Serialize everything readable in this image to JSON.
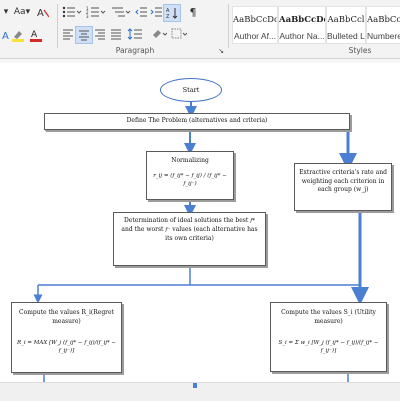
{
  "ribbon": {
    "font_aa": "Aa",
    "paragraph_mark": "¶",
    "styles": [
      {
        "preview": "AaBbCcDc",
        "name": "Author Af..."
      },
      {
        "preview": "AaBbCcDd",
        "name": "Author Na..."
      },
      {
        "preview": "AaBbCcl",
        "name": "Bulleted List"
      },
      {
        "preview": "AaBbCcDd",
        "name": "Numbere..."
      }
    ],
    "paragraph_label": "Paragraph",
    "styles_label": "Styles"
  },
  "flow": {
    "start": "Start",
    "define": "Define The Problem (alternatives and criteria)",
    "normalizing": "Normalizing",
    "normalizing_formula": "r_ij = (f_ij* − f_ij) / (f_ij* − f_ij⁻)",
    "extractive": "Extractive criteria's rate and weighting each criterion in each group (w_j)",
    "ideal_line1": "Determination of ideal solutions the best",
    "ideal_line2": "and the worst",
    "ideal_line3": "values (each alternative has its own criteria)",
    "regret_title": "Compute the values R_i(Regret measure)",
    "regret_formula": "R_i = MAX [W_j (f_ij* − f_ij)/(f_ij* − f_ij⁻)]",
    "utility_title": "Compute the values S_i (Utility measure)",
    "utility_formula": "S_i = Σ w_i [W_j (f_ij* − f_ij)/(f_ij* − f_ij⁻)]"
  },
  "colors": {
    "arrow_blue": "#4a7fd1",
    "oval_border": "#3f73c4"
  }
}
